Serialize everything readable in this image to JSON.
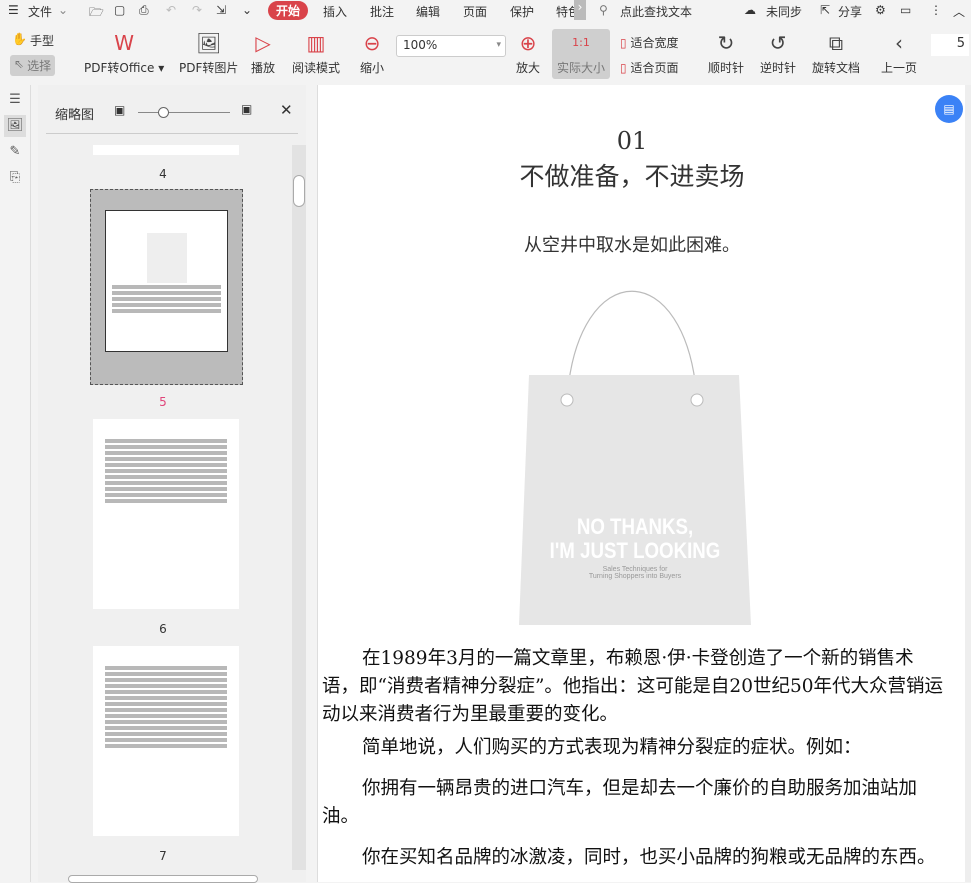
{
  "menu": {
    "file": "文件",
    "tabs": [
      "开始",
      "插入",
      "批注",
      "编辑",
      "页面",
      "保护",
      "特色"
    ],
    "search_placeholder": "点此查找文本",
    "sync": "未同步",
    "share": "分享"
  },
  "toolbar": {
    "hand": "手型",
    "select": "选择",
    "pdf_to_office": "PDF转Office",
    "pdf_to_image": "PDF转图片",
    "play": "播放",
    "read_mode": "阅读模式",
    "zoom_out": "缩小",
    "zoom_value": "100%",
    "zoom_in": "放大",
    "actual_size": "实际大小",
    "actual_size_icon": "1:1",
    "fit_width": "适合宽度",
    "fit_page": "适合页面",
    "clockwise": "顺时针",
    "counterclockwise": "逆时针",
    "rotate_doc": "旋转文档",
    "prev_page": "上一页",
    "page_number": "5"
  },
  "thumbnail_panel": {
    "title": "缩略图",
    "pages": [
      {
        "label": "4"
      },
      {
        "label": "5",
        "selected": true
      },
      {
        "label": "6"
      },
      {
        "label": "7"
      }
    ],
    "zoom_fraction": 0.3
  },
  "document": {
    "chapter": "01",
    "title": "不做准备，不进卖场",
    "subtitle": "从空井中取水是如此困难。",
    "book_cover": {
      "line1": "NO THANKS,",
      "line2": "I'M JUST LOOKING",
      "line3": "Sales Techniques for",
      "line4": "Turning Shoppers into Buyers"
    },
    "paragraphs": [
      "在1989年3月的一篇文章里，布赖恩·伊·卡登创造了一个新的销售术语，即“消费者精神分裂症”。他指出：这可能是自20世纪50年代大众营销运动以来消费者行为里最重要的变化。",
      "简单地说，人们购买的方式表现为精神分裂症的症状。例如：",
      "你拥有一辆昂贵的进口汽车，但是却去一个廉价的自助服务加油站加油。",
      "你在买知名品牌的冰激凌，同时，也买小品牌的狗粮或无品牌的东西。"
    ]
  },
  "colors": {
    "accent": "#d9434a",
    "selected_page_label": "#e0457a",
    "fab": "#3b82f6"
  }
}
